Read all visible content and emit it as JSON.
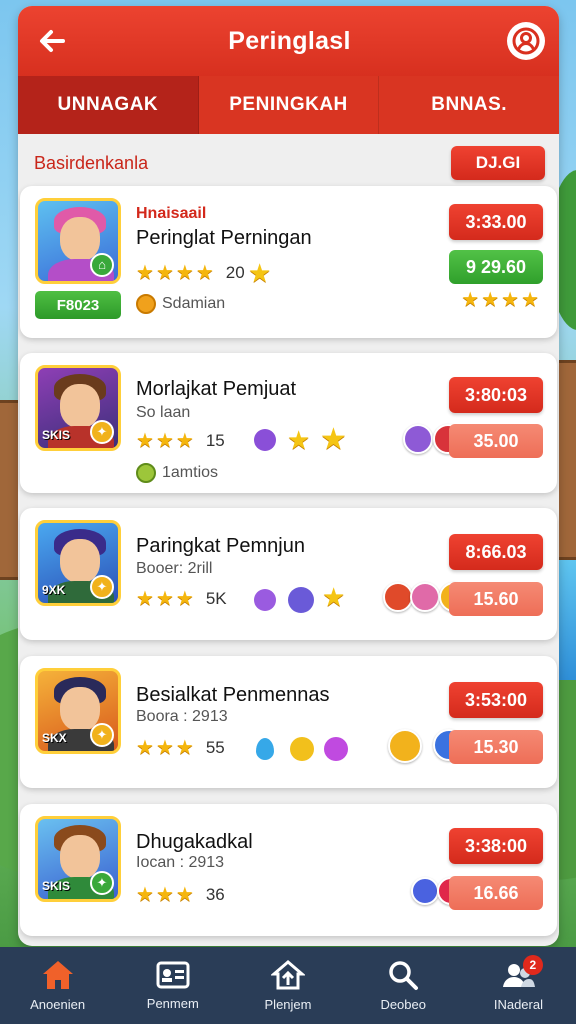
{
  "header": {
    "title": "Peringlasl"
  },
  "tabs": [
    {
      "label": "UNNAGAK",
      "active": true
    },
    {
      "label": "PENINGKAH",
      "active": false
    },
    {
      "label": "BNNAS.",
      "active": false
    }
  ],
  "subheader": {
    "label": "Basirdenkanla",
    "value": "DJ.GI"
  },
  "cards": [
    {
      "kicker": "Hnaisaail",
      "name": "Peringlat Perningan",
      "stars_count": "20",
      "sub": "Sdamian",
      "green_badge": "F8023",
      "score_top": "3:33.00",
      "score_mid": "9  29.60",
      "avatar_tag": ""
    },
    {
      "name": "Morlajkat Pemjuat",
      "sub": "So laan",
      "stars_count": "15",
      "extra": "1amtios",
      "score_top": "3:80:03",
      "score_mid": "35.00",
      "avatar_tag": "SKIS"
    },
    {
      "name": "Paringkat Pemnjun",
      "sub": "Booer: 2rill",
      "stars_count": "5K",
      "score_top": "8:66.03",
      "score_mid": "15.60",
      "avatar_tag": "9XK"
    },
    {
      "name": "Besialkat Penmennas",
      "sub": "Boora : 2913",
      "stars_count": "55",
      "score_top": "3:53:00",
      "score_mid": "15.30",
      "avatar_tag": "SKX"
    },
    {
      "name": "Dhugakadkal",
      "sub": "Iocan : 2913",
      "stars_count": "36",
      "score_top": "3:38:00",
      "score_mid": "16.66",
      "avatar_tag": "SKIS"
    }
  ],
  "nav": [
    {
      "label": "Anoenien",
      "icon": "home-icon"
    },
    {
      "label": "Penmem",
      "icon": "id-card-icon"
    },
    {
      "label": "Plenjem",
      "icon": "house-upload-icon"
    },
    {
      "label": "Deobeo",
      "icon": "search-icon"
    },
    {
      "label": "INaderal",
      "icon": "user-group-icon",
      "badge": "2"
    }
  ],
  "colors": {
    "primary": "#e03a26",
    "nav_bg": "#2a3d57",
    "green": "#3aad34",
    "star": "#f5b60d"
  }
}
